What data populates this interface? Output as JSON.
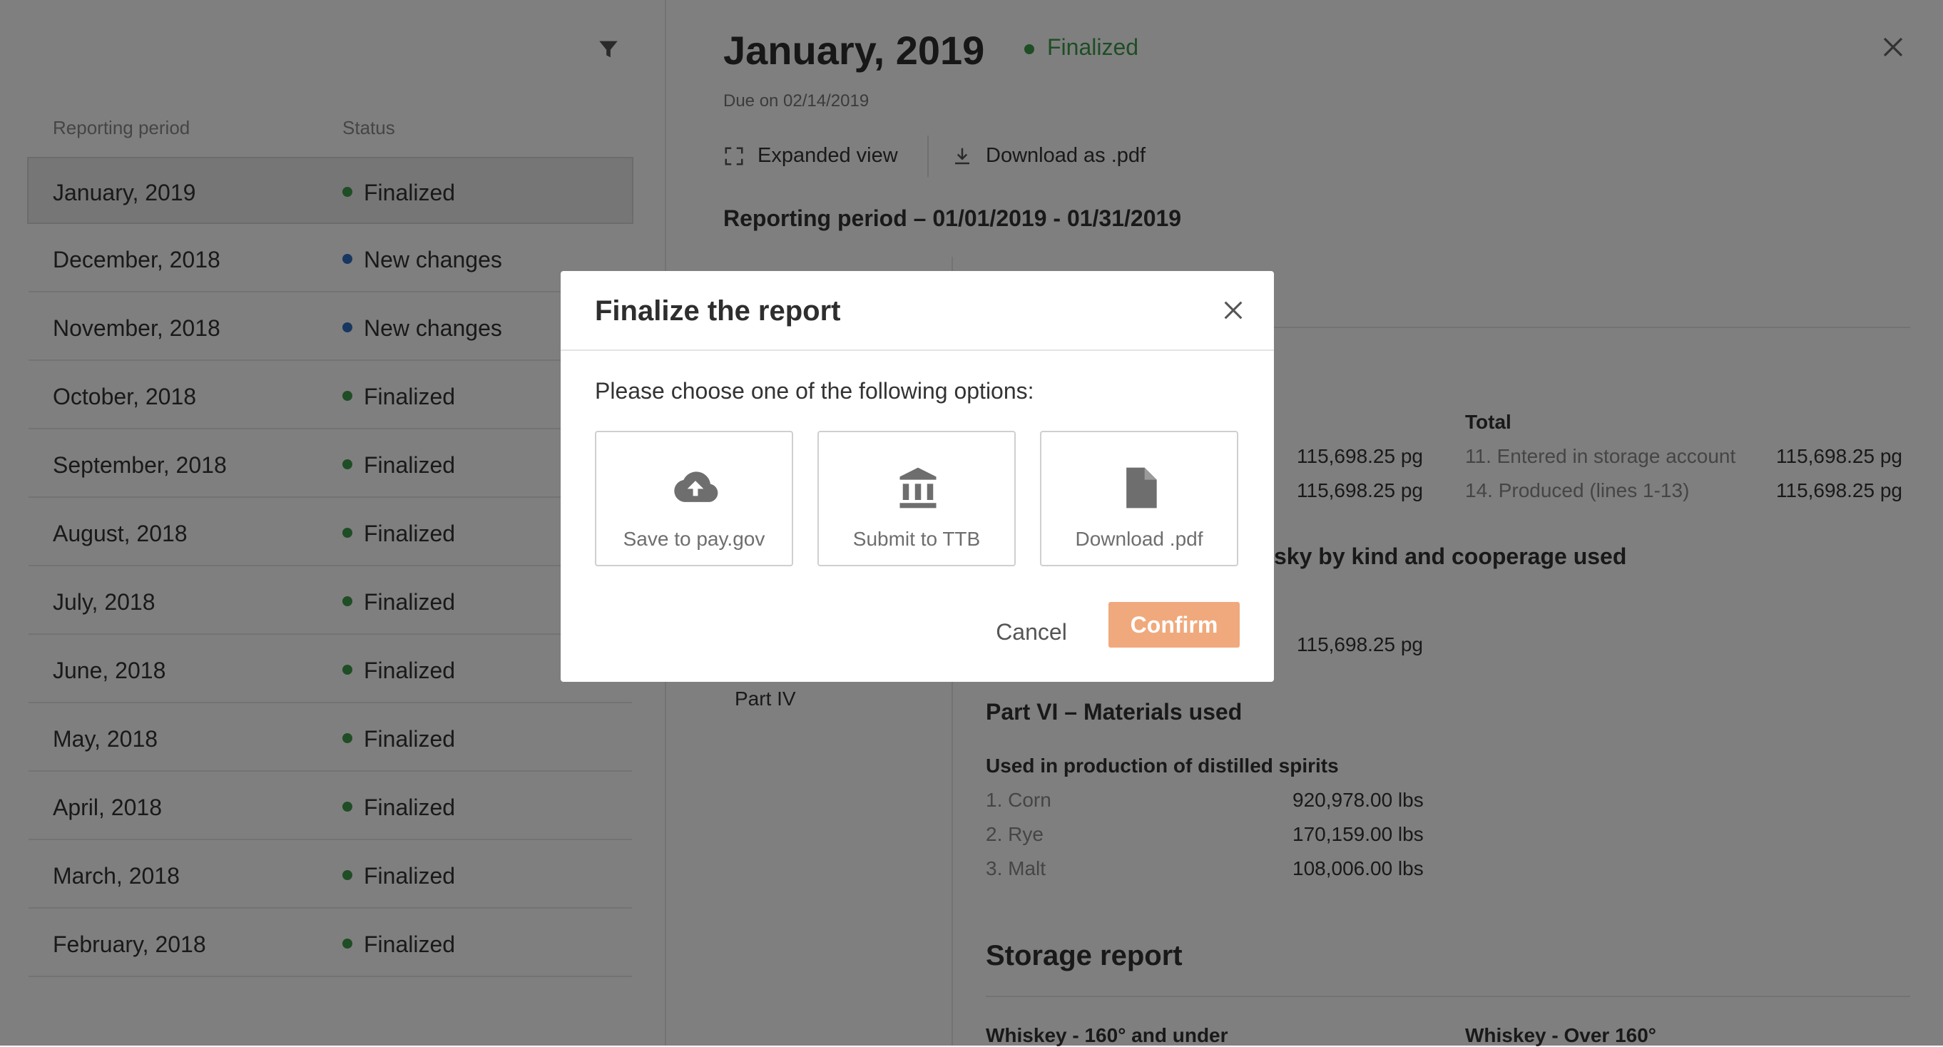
{
  "list": {
    "headers": {
      "period": "Reporting period",
      "status": "Status"
    },
    "rows": [
      {
        "period": "January, 2019",
        "status": "Finalized",
        "status_color": "#3e9b4b"
      },
      {
        "period": "December, 2018",
        "status": "New changes",
        "status_color": "#2f6fc2"
      },
      {
        "period": "November, 2018",
        "status": "New changes",
        "status_color": "#2f6fc2"
      },
      {
        "period": "October, 2018",
        "status": "Finalized",
        "status_color": "#3e9b4b"
      },
      {
        "period": "September, 2018",
        "status": "Finalized",
        "status_color": "#3e9b4b"
      },
      {
        "period": "August, 2018",
        "status": "Finalized",
        "status_color": "#3e9b4b"
      },
      {
        "period": "July, 2018",
        "status": "Finalized",
        "status_color": "#3e9b4b"
      },
      {
        "period": "June, 2018",
        "status": "Finalized",
        "status_color": "#3e9b4b"
      },
      {
        "period": "May, 2018",
        "status": "Finalized",
        "status_color": "#3e9b4b"
      },
      {
        "period": "April, 2018",
        "status": "Finalized",
        "status_color": "#3e9b4b"
      },
      {
        "period": "March, 2018",
        "status": "Finalized",
        "status_color": "#3e9b4b"
      },
      {
        "period": "February, 2018",
        "status": "Finalized",
        "status_color": "#3e9b4b"
      }
    ]
  },
  "detail": {
    "title": "January, 2019",
    "status": "Finalized",
    "status_color": "#3e9b4b",
    "due": "Due on 02/14/2019",
    "expanded_view": "Expanded view",
    "download_pdf": "Download as .pdf",
    "reporting_period": "Reporting period – 01/01/2019 - 01/31/2019",
    "nav_part_iv": "Part IV",
    "total_heading": "Total",
    "total_left_values": [
      "115,698.25 pg",
      "115,698.25 pg"
    ],
    "total_right": [
      {
        "label": "11. Entered in storage account",
        "value": "115,698.25 pg"
      },
      {
        "label": "14. Produced (lines 1-13)",
        "value": "115,698.25 pg"
      }
    ],
    "whisky_heading_fragment": "sky by kind and cooperage used",
    "whisky_value": "115,698.25 pg",
    "part_vi_heading": "Part VI – Materials used",
    "materials_subheading": "Used in production of distilled spirits",
    "materials": [
      {
        "label": "1. Corn",
        "value": "920,978.00 lbs"
      },
      {
        "label": "2. Rye",
        "value": "170,159.00 lbs"
      },
      {
        "label": "3. Malt",
        "value": "108,006.00 lbs"
      }
    ],
    "storage_heading": "Storage report",
    "storage_col_left": "Whiskey - 160° and under",
    "storage_col_right": "Whiskey - Over 160°"
  },
  "modal": {
    "title": "Finalize the report",
    "prompt": "Please choose one of the following options:",
    "options": [
      {
        "label": "Save to pay.gov",
        "icon": "cloud-upload-icon"
      },
      {
        "label": "Submit to TTB",
        "icon": "bank-icon"
      },
      {
        "label": "Download .pdf",
        "icon": "document-icon"
      }
    ],
    "cancel": "Cancel",
    "confirm": "Confirm",
    "confirm_color": "#f0a97c"
  }
}
